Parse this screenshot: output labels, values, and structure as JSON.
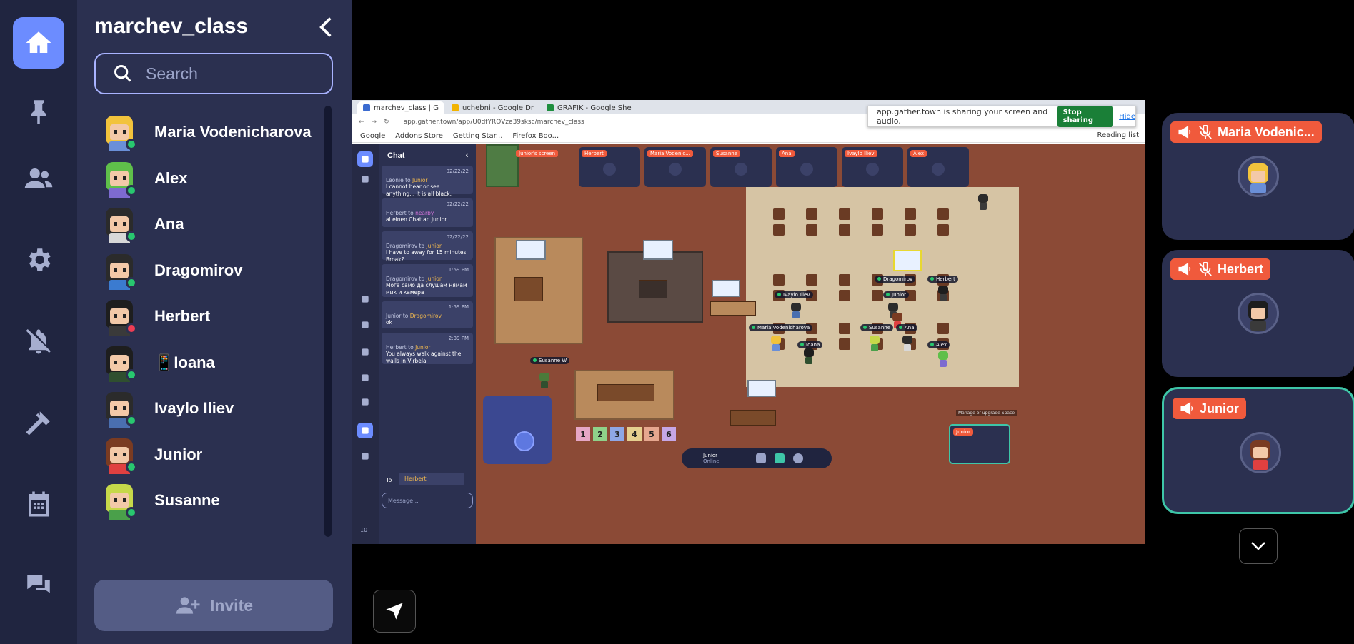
{
  "sidebar_rail": {
    "items": [
      {
        "icon": "home-icon",
        "active": true
      },
      {
        "icon": "pin-icon"
      },
      {
        "icon": "people-icon"
      },
      {
        "icon": "gear-icon"
      },
      {
        "icon": "bell-off-icon"
      },
      {
        "icon": "hammer-icon"
      },
      {
        "icon": "calendar-icon"
      },
      {
        "icon": "chat-icon"
      }
    ]
  },
  "panel": {
    "title": "marchev_class",
    "search_placeholder": "Search",
    "invite_label": "Invite"
  },
  "members": [
    {
      "name": "Maria Vodenicharova",
      "status": "online",
      "hair": "#f2c33c",
      "shirt": "#6a8fd8"
    },
    {
      "name": "Alex",
      "status": "online",
      "hair": "#5fbf4a",
      "shirt": "#7d6bd0"
    },
    {
      "name": "Ana",
      "status": "online",
      "hair": "#2b2b2b",
      "shirt": "#d8d8d8"
    },
    {
      "name": "Dragomirov",
      "status": "online",
      "hair": "#2b2b2b",
      "shirt": "#3b7bd0"
    },
    {
      "name": "Herbert",
      "status": "busy",
      "hair": "#1e1e1e",
      "shirt": "#3a3a3a"
    },
    {
      "name": "📱Ioana",
      "status": "online",
      "hair": "#1e1e1e",
      "shirt": "#2f4f2f"
    },
    {
      "name": "Ivaylo Iliev",
      "status": "online",
      "hair": "#2b2b2b",
      "shirt": "#4a6fb0"
    },
    {
      "name": "Junior",
      "status": "online",
      "hair": "#7a3b22",
      "shirt": "#e04040"
    },
    {
      "name": "Susanne",
      "status": "online",
      "hair": "#c6d84a",
      "shirt": "#4aa04a"
    }
  ],
  "browser": {
    "tabs": [
      {
        "label": "marchev_class | G",
        "color": "#3b6bd0"
      },
      {
        "label": "uchebni - Google Dr",
        "color": "#f2b300"
      },
      {
        "label": "GRAFIK - Google She",
        "color": "#1e8e3e"
      }
    ],
    "url": "app.gather.town/app/U0dfYROVze39sksc/marchev_class",
    "bookmarks": [
      "Google",
      "Addons Store",
      "Getting Star...",
      "Firefox Boo..."
    ],
    "reading_list": "Reading list",
    "share_notice": "app.gather.town is sharing your screen and audio.",
    "stop_sharing": "Stop sharing",
    "hide": "Hide"
  },
  "game": {
    "chat_title": "Chat",
    "messages": [
      {
        "time": "02/22/22",
        "from": "Leonie",
        "to": "Junior",
        "text": "I cannot hear or see anything... It is all black."
      },
      {
        "time": "02/22/22",
        "from": "Herbert",
        "to": "nearby",
        "text": "al einen Chat an Junior"
      },
      {
        "time": "02/22/22",
        "from": "Dragomirov",
        "to": "Junior",
        "text": "I have to away for 15 minutes. Broak?"
      },
      {
        "time": "1:59 PM",
        "from": "Dragomirov",
        "to": "Junior",
        "text": "Мога само да слушам нямам мик и камера"
      },
      {
        "time": "1:59 PM",
        "from": "Junior",
        "to": "Dragomirov",
        "text": "ok"
      },
      {
        "time": "2:39 PM",
        "from": "Herbert",
        "to": "Junior",
        "text": "You always walk against the walls in Virbela"
      }
    ],
    "to_label": "To",
    "to_value": "Herbert",
    "message_placeholder": "Message...",
    "online_count": "10",
    "video_tiles": [
      "Junior's screen",
      "Herbert",
      "Maria Vodenic...",
      "Susanne",
      "Ana",
      "Ivaylo Iliev",
      "Alex"
    ],
    "name_labels": [
      "Dragomirov",
      "Herbert",
      "Ivaylo Iliev",
      "Junior",
      "Maria Vodenicharova",
      "Susanne",
      "Ana",
      "Ioana",
      "Alex",
      "Susanne W"
    ],
    "number_tiles": [
      "1",
      "2",
      "3",
      "4",
      "5",
      "6"
    ],
    "self_name": "Junior",
    "self_status": "Online",
    "self_cam_label": "Junior",
    "manage_text": "Manage or upgrade Space"
  },
  "videos": [
    {
      "name": "Maria Vodenic...",
      "muted": true,
      "hair": "#f2c33c",
      "shirt": "#6a8fd8"
    },
    {
      "name": "Herbert",
      "muted": true,
      "hair": "#1e1e1e",
      "shirt": "#3a3a3a"
    },
    {
      "name": "Junior",
      "muted": false,
      "active": true,
      "hair": "#7a3b22",
      "shirt": "#e04040"
    }
  ],
  "colors": {
    "accent": "#6c8cff",
    "rail_bg": "#202540",
    "panel_bg": "#2b3050",
    "label_orange": "#f05a3c",
    "active_border": "#3ec6a8"
  }
}
